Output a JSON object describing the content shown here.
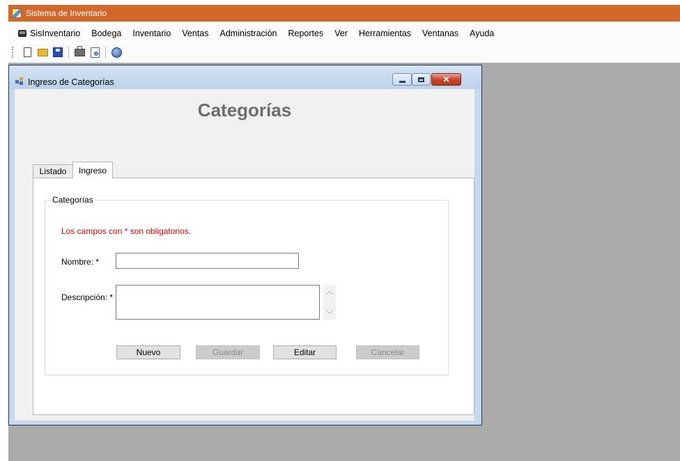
{
  "app": {
    "title": "Sistema de Inventario"
  },
  "menubar": {
    "items": [
      "SisInventario",
      "Bodega",
      "Inventario",
      "Ventas",
      "Administración",
      "Reportes",
      "Ver",
      "Herramientas",
      "Ventanas",
      "Ayuda"
    ]
  },
  "toolbar": {
    "buttons": [
      "new-icon",
      "open-icon",
      "save-icon",
      "print-icon",
      "print-preview-icon",
      "help-icon"
    ]
  },
  "child_window": {
    "title": "Ingreso de Categorías",
    "heading": "Categorías",
    "tabs": {
      "listado": "Listado",
      "ingreso": "Ingreso"
    },
    "group": {
      "legend": "Categorías",
      "required_note": "Los campos con * son obligatorios.",
      "nombre_label": "Nombre: *",
      "nombre_value": "",
      "descripcion_label": "Descripción: *",
      "descripcion_value": ""
    },
    "buttons": {
      "nuevo": "Nuevo",
      "guardar": "Guardar",
      "editar": "Editar",
      "cancelar": "Cancelar"
    }
  },
  "colors": {
    "app_titlebar": "#d2692a",
    "mdi_background": "#ababab",
    "required_text": "#e00000",
    "heading_text": "#6d6d6d"
  }
}
